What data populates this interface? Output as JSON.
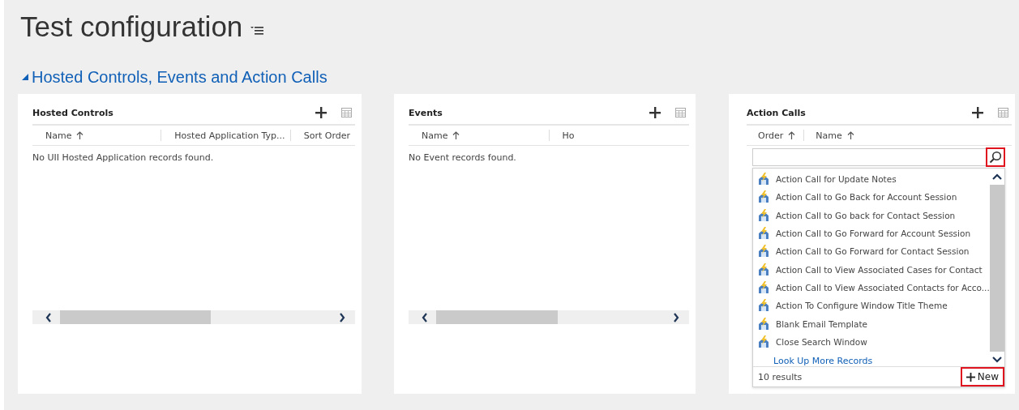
{
  "page": {
    "title": "Test configuration"
  },
  "section": {
    "title": "Hosted Controls, Events and Action Calls",
    "expanded": true
  },
  "panels": [
    {
      "title": "Hosted Controls",
      "columns": [
        {
          "label": "Name",
          "sorted": true
        },
        {
          "label": "Hosted Application Typ...",
          "sorted": false
        },
        {
          "label": "Sort Order",
          "sorted": false
        }
      ],
      "empty_message": "No UII Hosted Application records found."
    },
    {
      "title": "Events",
      "columns": [
        {
          "label": "Name",
          "sorted": true
        },
        {
          "label": "Ho",
          "sorted": false
        }
      ],
      "empty_message": "No Event records found."
    },
    {
      "title": "Action Calls",
      "columns": [
        {
          "label": "Order",
          "sorted": true
        },
        {
          "label": "Name",
          "sorted": true
        }
      ],
      "lookup": {
        "results": "10 results",
        "more_link": "Look Up More Records",
        "new_label": "New",
        "items": [
          {
            "label": "Action Call for Update Notes"
          },
          {
            "label": "Action Call to Go Back for Account Session"
          },
          {
            "label": "Action Call to Go back for Contact Session"
          },
          {
            "label": "Action Call to Go Forward for Account Session"
          },
          {
            "label": "Action Call to Go Forward for Contact Session"
          },
          {
            "label": "Action Call to View Associated Cases for Contact"
          },
          {
            "label": "Action Call to View Associated Contacts for Acco..."
          },
          {
            "label": "Action To Configure Window Title Theme"
          },
          {
            "label": "Blank Email Template"
          },
          {
            "label": "Close Search Window"
          }
        ]
      }
    }
  ]
}
